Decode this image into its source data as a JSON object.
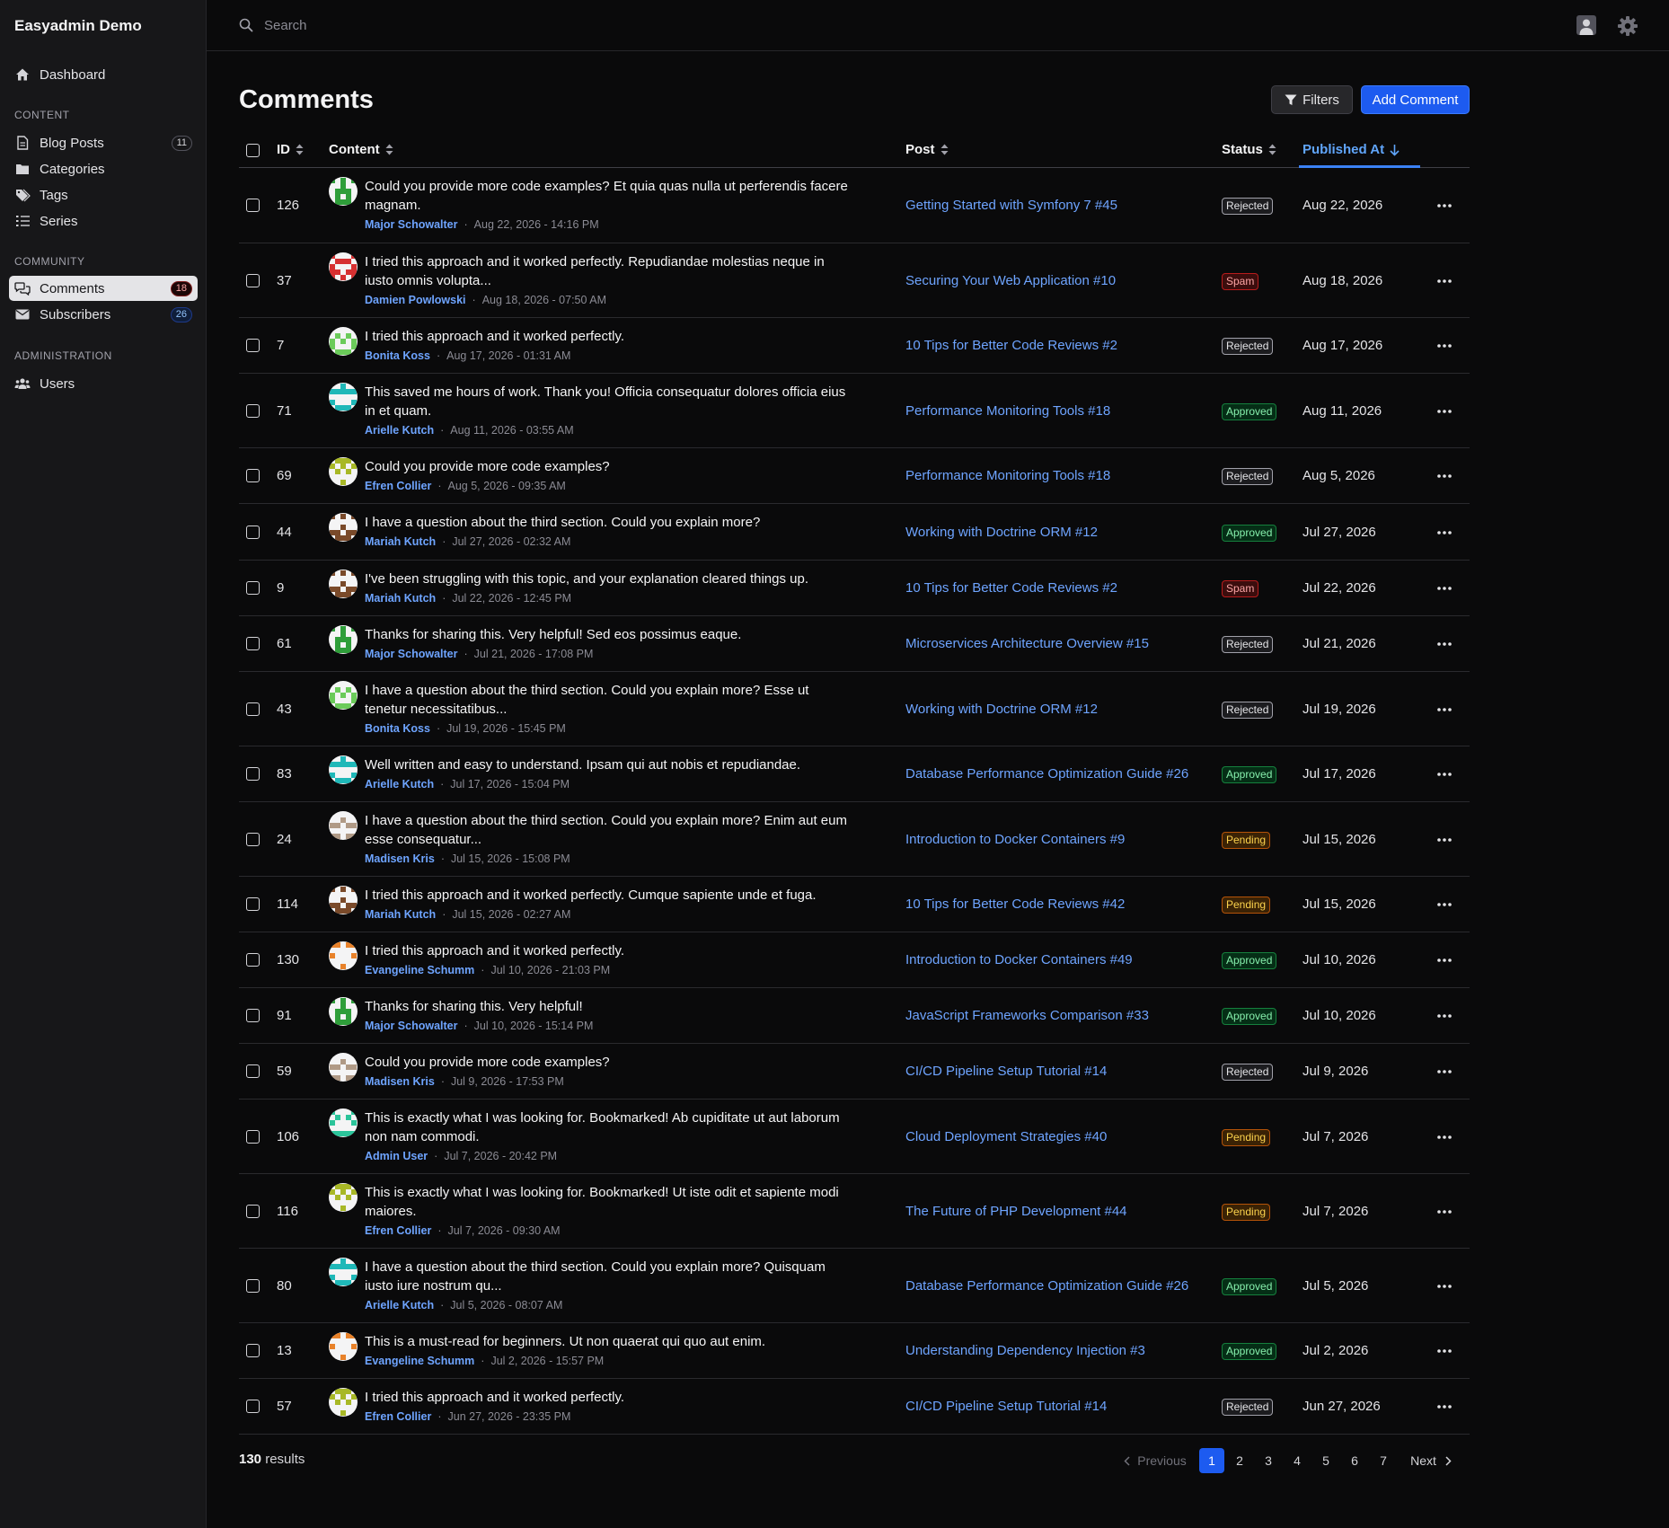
{
  "app": {
    "title": "Easyadmin Demo"
  },
  "nav": {
    "dashboard": "Dashboard",
    "section_content": "CONTENT",
    "blog_posts": "Blog Posts",
    "blog_posts_count": "11",
    "categories": "Categories",
    "tags": "Tags",
    "series": "Series",
    "section_community": "COMMUNITY",
    "comments": "Comments",
    "comments_count": "18",
    "subscribers": "Subscribers",
    "subscribers_count": "26",
    "section_admin": "ADMINISTRATION",
    "users": "Users"
  },
  "search": {
    "placeholder": "Search"
  },
  "page": {
    "title": "Comments",
    "filters_label": "Filters",
    "add_label": "Add Comment"
  },
  "table": {
    "headers": {
      "id": "ID",
      "content": "Content",
      "post": "Post",
      "status": "Status",
      "published": "Published At"
    },
    "rows": [
      {
        "id": "126",
        "text": "Could you provide more code examples? Et quia quas nulla ut perferendis facere magnam.",
        "author": "Major Schowalter",
        "date": "Aug 22, 2026 - 14:16 PM",
        "post": "Getting Started with Symfony 7 #45",
        "status": "Rejected",
        "published": "Aug 22, 2026"
      },
      {
        "id": "37",
        "text": "I tried this approach and it worked perfectly. Repudiandae molestias neque in iusto omnis volupta...",
        "author": "Damien Powlowski",
        "date": "Aug 18, 2026 - 07:50 AM",
        "post": "Securing Your Web Application #10",
        "status": "Spam",
        "published": "Aug 18, 2026"
      },
      {
        "id": "7",
        "text": "I tried this approach and it worked perfectly.",
        "author": "Bonita Koss",
        "date": "Aug 17, 2026 - 01:31 AM",
        "post": "10 Tips for Better Code Reviews #2",
        "status": "Rejected",
        "published": "Aug 17, 2026"
      },
      {
        "id": "71",
        "text": "This saved me hours of work. Thank you! Officia consequatur dolores officia eius in et quam.",
        "author": "Arielle Kutch",
        "date": "Aug 11, 2026 - 03:55 AM",
        "post": "Performance Monitoring Tools #18",
        "status": "Approved",
        "published": "Aug 11, 2026"
      },
      {
        "id": "69",
        "text": "Could you provide more code examples?",
        "author": "Efren Collier",
        "date": "Aug 5, 2026 - 09:35 AM",
        "post": "Performance Monitoring Tools #18",
        "status": "Rejected",
        "published": "Aug 5, 2026"
      },
      {
        "id": "44",
        "text": "I have a question about the third section. Could you explain more?",
        "author": "Mariah Kutch",
        "date": "Jul 27, 2026 - 02:32 AM",
        "post": "Working with Doctrine ORM #12",
        "status": "Approved",
        "published": "Jul 27, 2026"
      },
      {
        "id": "9",
        "text": "I've been struggling with this topic, and your explanation cleared things up.",
        "author": "Mariah Kutch",
        "date": "Jul 22, 2026 - 12:45 PM",
        "post": "10 Tips for Better Code Reviews #2",
        "status": "Spam",
        "published": "Jul 22, 2026"
      },
      {
        "id": "61",
        "text": "Thanks for sharing this. Very helpful! Sed eos possimus eaque.",
        "author": "Major Schowalter",
        "date": "Jul 21, 2026 - 17:08 PM",
        "post": "Microservices Architecture Overview #15",
        "status": "Rejected",
        "published": "Jul 21, 2026"
      },
      {
        "id": "43",
        "text": "I have a question about the third section. Could you explain more? Esse ut tenetur necessitatibus...",
        "author": "Bonita Koss",
        "date": "Jul 19, 2026 - 15:45 PM",
        "post": "Working with Doctrine ORM #12",
        "status": "Rejected",
        "published": "Jul 19, 2026"
      },
      {
        "id": "83",
        "text": "Well written and easy to understand. Ipsam qui aut nobis et repudiandae.",
        "author": "Arielle Kutch",
        "date": "Jul 17, 2026 - 15:04 PM",
        "post": "Database Performance Optimization Guide #26",
        "status": "Approved",
        "published": "Jul 17, 2026"
      },
      {
        "id": "24",
        "text": "I have a question about the third section. Could you explain more? Enim aut eum esse consequatur...",
        "author": "Madisen Kris",
        "date": "Jul 15, 2026 - 15:08 PM",
        "post": "Introduction to Docker Containers #9",
        "status": "Pending",
        "published": "Jul 15, 2026"
      },
      {
        "id": "114",
        "text": "I tried this approach and it worked perfectly. Cumque sapiente unde et fuga.",
        "author": "Mariah Kutch",
        "date": "Jul 15, 2026 - 02:27 AM",
        "post": "10 Tips for Better Code Reviews #42",
        "status": "Pending",
        "published": "Jul 15, 2026"
      },
      {
        "id": "130",
        "text": "I tried this approach and it worked perfectly.",
        "author": "Evangeline Schumm",
        "date": "Jul 10, 2026 - 21:03 PM",
        "post": "Introduction to Docker Containers #49",
        "status": "Approved",
        "published": "Jul 10, 2026"
      },
      {
        "id": "91",
        "text": "Thanks for sharing this. Very helpful!",
        "author": "Major Schowalter",
        "date": "Jul 10, 2026 - 15:14 PM",
        "post": "JavaScript Frameworks Comparison #33",
        "status": "Approved",
        "published": "Jul 10, 2026"
      },
      {
        "id": "59",
        "text": "Could you provide more code examples?",
        "author": "Madisen Kris",
        "date": "Jul 9, 2026 - 17:53 PM",
        "post": "CI/CD Pipeline Setup Tutorial #14",
        "status": "Rejected",
        "published": "Jul 9, 2026"
      },
      {
        "id": "106",
        "text": "This is exactly what I was looking for. Bookmarked! Ab cupiditate ut aut laborum non nam commodi.",
        "author": "Admin User",
        "date": "Jul 7, 2026 - 20:42 PM",
        "post": "Cloud Deployment Strategies #40",
        "status": "Pending",
        "published": "Jul 7, 2026"
      },
      {
        "id": "116",
        "text": "This is exactly what I was looking for. Bookmarked! Ut iste odit et sapiente modi maiores.",
        "author": "Efren Collier",
        "date": "Jul 7, 2026 - 09:30 AM",
        "post": "The Future of PHP Development #44",
        "status": "Pending",
        "published": "Jul 7, 2026"
      },
      {
        "id": "80",
        "text": "I have a question about the third section. Could you explain more? Quisquam iusto iure nostrum qu...",
        "author": "Arielle Kutch",
        "date": "Jul 5, 2026 - 08:07 AM",
        "post": "Database Performance Optimization Guide #26",
        "status": "Approved",
        "published": "Jul 5, 2026"
      },
      {
        "id": "13",
        "text": "This is a must-read for beginners. Ut non quaerat qui quo aut enim.",
        "author": "Evangeline Schumm",
        "date": "Jul 2, 2026 - 15:57 PM",
        "post": "Understanding Dependency Injection #3",
        "status": "Approved",
        "published": "Jul 2, 2026"
      },
      {
        "id": "57",
        "text": "I tried this approach and it worked perfectly.",
        "author": "Efren Collier",
        "date": "Jun 27, 2026 - 23:35 PM",
        "post": "CI/CD Pipeline Setup Tutorial #14",
        "status": "Rejected",
        "published": "Jun 27, 2026"
      }
    ]
  },
  "avatar_colors": {
    "Major Schowalter": "#2f9e3a",
    "Damien Powlowski": "#d63031",
    "Bonita Koss": "#6bcb5a",
    "Arielle Kutch": "#1fb8b8",
    "Efren Collier": "#a8b826",
    "Mariah Kutch": "#7a4a2a",
    "Madisen Kris": "#b09a86",
    "Evangeline Schumm": "#e8822a",
    "Admin User": "#2bc49a"
  },
  "footer": {
    "results_count": "130",
    "results_label": "results",
    "previous": "Previous",
    "next": "Next",
    "pages": [
      "1",
      "2",
      "3",
      "4",
      "5",
      "6",
      "7"
    ],
    "current_page": "1"
  }
}
